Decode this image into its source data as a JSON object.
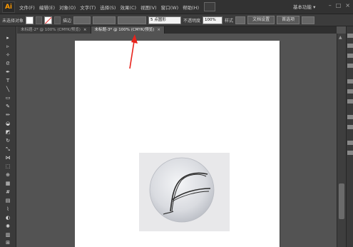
{
  "app": {
    "logo": "Ai"
  },
  "menu": [
    "文件(F)",
    "编辑(E)",
    "对象(O)",
    "文字(T)",
    "选择(S)",
    "效果(C)",
    "视图(V)",
    "窗口(W)",
    "帮助(H)"
  ],
  "workspace": {
    "label": "基本功能 ▾"
  },
  "control_bar": {
    "selection_status": "未选择对象",
    "stroke_label": "描边",
    "stroke_value": "",
    "brush_label": "5 点圆形",
    "opacity_label": "不透明度",
    "opacity_value": "100%",
    "style_label": "样式",
    "doc_setup_button": "文档设置",
    "prefs_button": "首选项"
  },
  "tabs": [
    {
      "label": "未标题-2* @ 100% (CMYK/预览)",
      "close": "×"
    },
    {
      "label": "未标题-3* @ 100% (CMYK/预览)",
      "close": "×"
    }
  ],
  "window_controls": {
    "minimize": "–",
    "maximize": "□",
    "close": "×"
  },
  "colors": {
    "accent": "#ff9a00",
    "arrow": "#e8231c",
    "canvas_bg": "#535353"
  }
}
